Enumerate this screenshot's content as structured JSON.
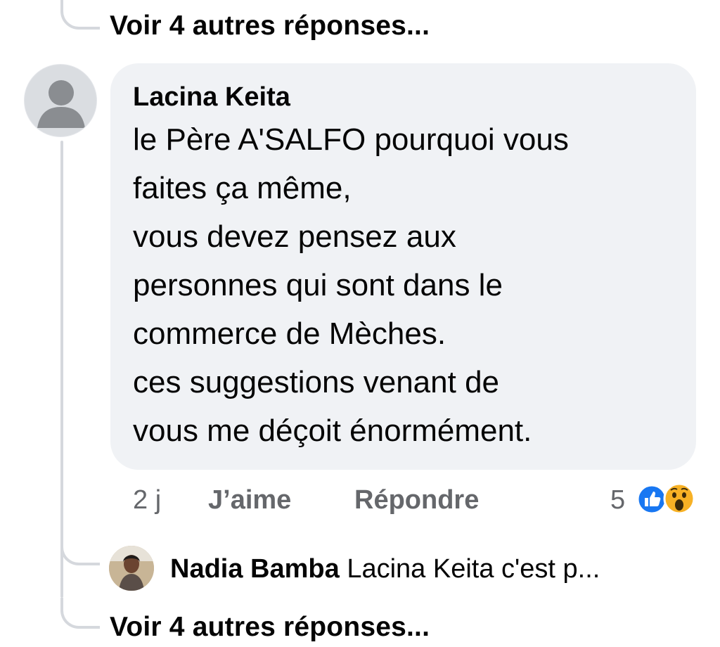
{
  "thread": {
    "see_more_top": "Voir 4 autres réponses...",
    "see_more_bottom": "Voir 4 autres réponses..."
  },
  "comment": {
    "author": "Lacina Keita",
    "text_lines": [
      "le Père A'SALFO pourquoi vous",
      "faites ça même,",
      "vous devez pensez aux",
      "personnes qui sont dans le",
      "commerce de Mèches.",
      "ces suggestions venant de",
      "vous me déçoit énormément."
    ],
    "time": "2 j",
    "like_label": "J’aime",
    "reply_label": "Répondre",
    "reaction_count": "5",
    "reactions": [
      "like-icon",
      "wow-icon"
    ],
    "colors": {
      "like": "#1877f2",
      "wow": "#f7b125"
    }
  },
  "reply": {
    "author": "Nadia Bamba",
    "preview": "Lacina Keita c'est p..."
  }
}
